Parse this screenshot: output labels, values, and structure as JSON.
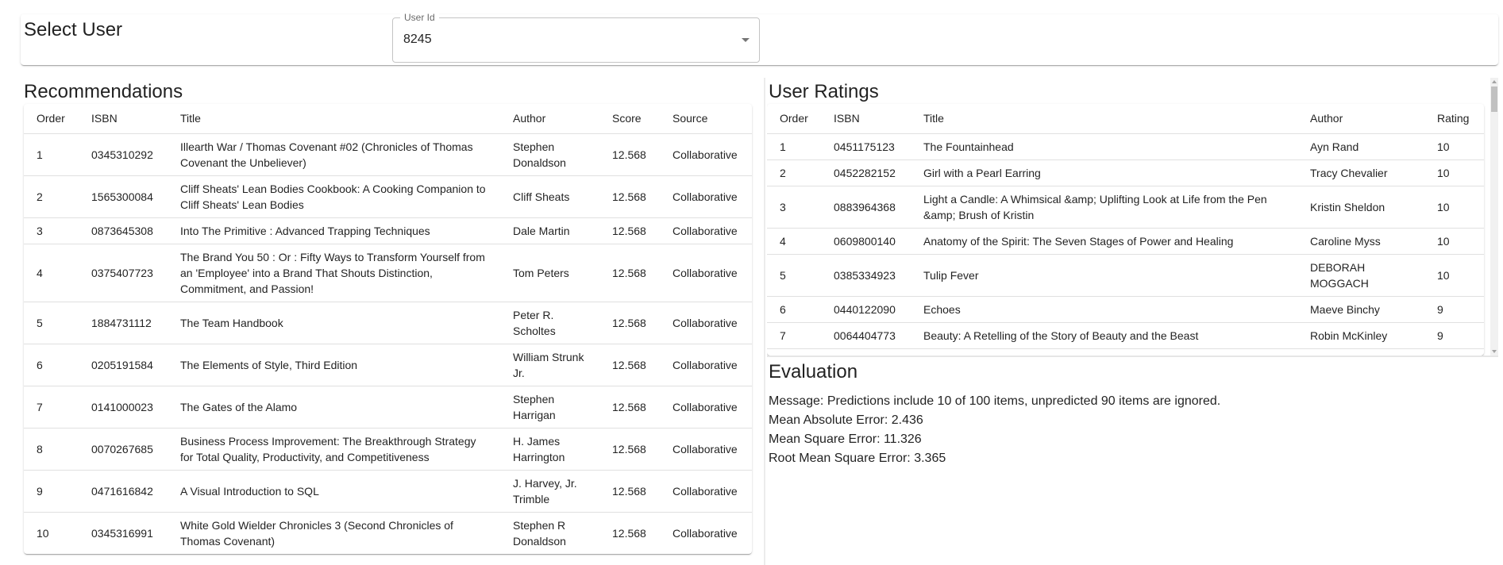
{
  "header": {
    "title": "Select User",
    "userid_label": "User Id",
    "userid_value": "8245"
  },
  "recommendations": {
    "title": "Recommendations",
    "columns": [
      "Order",
      "ISBN",
      "Title",
      "Author",
      "Score",
      "Source"
    ],
    "rows": [
      [
        "1",
        "0345310292",
        "Illearth War / Thomas Covenant #02 (Chronicles of Thomas Covenant the Unbeliever)",
        "Stephen Donaldson",
        "12.568",
        "Collaborative"
      ],
      [
        "2",
        "1565300084",
        "Cliff Sheats' Lean Bodies Cookbook: A Cooking Companion to Cliff Sheats' Lean Bodies",
        "Cliff Sheats",
        "12.568",
        "Collaborative"
      ],
      [
        "3",
        "0873645308",
        "Into The Primitive : Advanced Trapping Techniques",
        "Dale Martin",
        "12.568",
        "Collaborative"
      ],
      [
        "4",
        "0375407723",
        "The Brand You 50 : Or : Fifty Ways to Transform Yourself from an 'Employee' into a Brand That Shouts Distinction, Commitment, and Passion!",
        "Tom Peters",
        "12.568",
        "Collaborative"
      ],
      [
        "5",
        "1884731112",
        "The Team Handbook",
        "Peter R. Scholtes",
        "12.568",
        "Collaborative"
      ],
      [
        "6",
        "0205191584",
        "The Elements of Style, Third Edition",
        "William Strunk Jr.",
        "12.568",
        "Collaborative"
      ],
      [
        "7",
        "0141000023",
        "The Gates of the Alamo",
        "Stephen Harrigan",
        "12.568",
        "Collaborative"
      ],
      [
        "8",
        "0070267685",
        "Business Process Improvement: The Breakthrough Strategy for Total Quality, Productivity, and Competitiveness",
        "H. James Harrington",
        "12.568",
        "Collaborative"
      ],
      [
        "9",
        "0471616842",
        "A Visual Introduction to SQL",
        "J. Harvey, Jr. Trimble",
        "12.568",
        "Collaborative"
      ],
      [
        "10",
        "0345316991",
        "White Gold Wielder Chronicles 3 (Second Chronicles of Thomas Covenant)",
        "Stephen R Donaldson",
        "12.568",
        "Collaborative"
      ]
    ]
  },
  "ratings": {
    "title": "User Ratings",
    "columns": [
      "Order",
      "ISBN",
      "Title",
      "Author",
      "Rating"
    ],
    "rows": [
      [
        "1",
        "0451175123",
        "The Fountainhead",
        "Ayn Rand",
        "10"
      ],
      [
        "2",
        "0452282152",
        "Girl with a Pearl Earring",
        "Tracy Chevalier",
        "10"
      ],
      [
        "3",
        "0883964368",
        "Light a Candle: A Whimsical &amp; Uplifting Look at Life from the Pen &amp; Brush of Kristin",
        "Kristin Sheldon",
        "10"
      ],
      [
        "4",
        "0609800140",
        "Anatomy of the Spirit: The Seven Stages of Power and Healing",
        "Caroline Myss",
        "10"
      ],
      [
        "5",
        "0385334923",
        "Tulip Fever",
        "DEBORAH MOGGACH",
        "10"
      ],
      [
        "6",
        "0440122090",
        "Echoes",
        "Maeve Binchy",
        "9"
      ],
      [
        "7",
        "0064404773",
        "Beauty: A Retelling of the Story of Beauty and the Beast",
        "Robin McKinley",
        "9"
      ]
    ]
  },
  "evaluation": {
    "title": "Evaluation",
    "message": "Message: Predictions include 10 of 100 items, unpredicted 90 items are ignored.",
    "mae": "Mean Absolute Error: 2.436",
    "mse": "Mean Square Error: 11.326",
    "rmse": "Root Mean Square Error: 3.365"
  }
}
